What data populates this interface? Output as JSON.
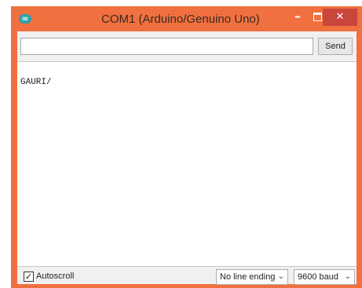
{
  "window": {
    "title": "COM1 (Arduino/Genuino Uno)",
    "icon": "arduino-infinity-icon",
    "accent_color": "#f0703f",
    "close_color": "#c9463d",
    "controls": {
      "minimize_glyph": "–",
      "close_glyph": "✕"
    }
  },
  "send_bar": {
    "input_value": "",
    "send_label": "Send"
  },
  "output": {
    "text": "GAURI/"
  },
  "footer": {
    "autoscroll_label": "Autoscroll",
    "autoscroll_checked": true,
    "check_glyph": "✓",
    "line_ending": "No line ending",
    "baud_rate": "9600 baud",
    "chevron_glyph": "⌄"
  }
}
